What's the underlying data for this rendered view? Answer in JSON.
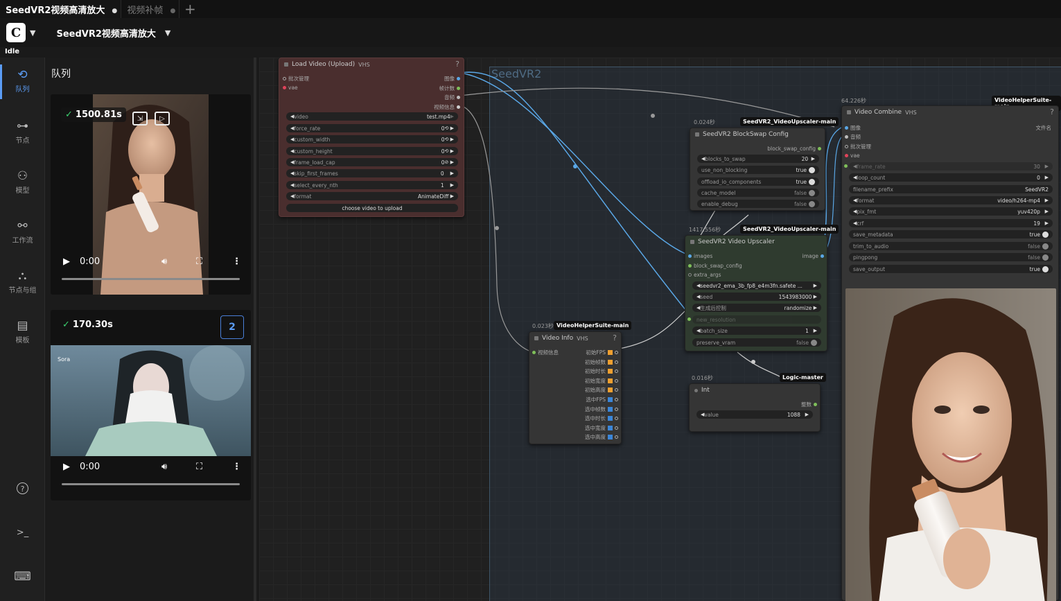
{
  "tabs": [
    {
      "label": "SeedVR2视频高清放大",
      "active": true
    },
    {
      "label": "视频补帧",
      "active": false
    }
  ],
  "workflow_name": "SeedVR2视频高清放大",
  "status": "Idle",
  "sidebar": [
    {
      "label": "队列",
      "icon": "history-icon",
      "glyph": "⟲",
      "active": true
    },
    {
      "label": "节点",
      "icon": "node-icon",
      "glyph": "⊶",
      "active": false
    },
    {
      "label": "模型",
      "icon": "model-library-icon",
      "glyph": "⚇",
      "active": false
    },
    {
      "label": "工作流",
      "icon": "workflow-icon",
      "glyph": "⚯",
      "active": false
    },
    {
      "label": "节点与组",
      "icon": "node-group-icon",
      "glyph": "⛬",
      "active": false
    },
    {
      "label": "模板",
      "icon": "template-icon",
      "glyph": "▤",
      "active": false
    }
  ],
  "sidebar_bottom": [
    {
      "icon": "help-icon",
      "glyph": "?"
    },
    {
      "icon": "terminal-icon",
      "glyph": ">_"
    },
    {
      "icon": "keyboard-icon",
      "glyph": "⌨"
    }
  ],
  "queue": {
    "title": "队列",
    "items": [
      {
        "time": "1500.81s",
        "check": "✓",
        "video_time": "0:00"
      },
      {
        "time": "170.30s",
        "check": "✓",
        "count": "2",
        "video_time": "0:00",
        "watermark": "Sora"
      }
    ]
  },
  "canvas": {
    "group_title": "SeedVR2",
    "load_video": {
      "title": "Load Video (Upload)",
      "badge": "VHS",
      "inputs": [
        "批次管理",
        "vae"
      ],
      "outputs": [
        "图像",
        "帧计数",
        "音频",
        "视频信息"
      ],
      "widgets": [
        {
          "label": "video",
          "value": "test.mp4"
        },
        {
          "label": "force_rate",
          "value": "0"
        },
        {
          "label": "custom_width",
          "value": "0"
        },
        {
          "label": "custom_height",
          "value": "0"
        },
        {
          "label": "frame_load_cap",
          "value": "0"
        },
        {
          "label": "skip_first_frames",
          "value": "0"
        },
        {
          "label": "select_every_nth",
          "value": "1"
        },
        {
          "label": "format",
          "value": "AnimateDiff"
        }
      ],
      "upload_label": "choose video to upload"
    },
    "blockswap": {
      "time": "0.024秒",
      "source": "SeedVR2_VideoUpscaler-main",
      "title": "SeedVR2 BlockSwap Config",
      "output": "block_swap_config",
      "widgets": [
        {
          "label": "blocks_to_swap",
          "value": "20"
        },
        {
          "label": "use_non_blocking",
          "value": "true"
        },
        {
          "label": "offload_io_components",
          "value": "true"
        },
        {
          "label": "cache_model",
          "value": "false"
        },
        {
          "label": "enable_debug",
          "value": "false"
        }
      ]
    },
    "upscaler": {
      "time": "1417.556秒",
      "source": "SeedVR2_VideoUpscaler-main",
      "title": "SeedVR2 Video Upscaler",
      "inputs": [
        "images",
        "block_swap_config",
        "extra_args"
      ],
      "output": "image",
      "widgets": [
        {
          "label": "seedvr2_ema_3b_fp8_e4m3fn.safete ...",
          "value": ""
        },
        {
          "label": "seed",
          "value": "1543983000"
        },
        {
          "label": "生成后控制",
          "value": "randomize"
        },
        {
          "label": "new_resolution",
          "value": ""
        },
        {
          "label": "batch_size",
          "value": "1"
        },
        {
          "label": "preserve_vram",
          "value": "false"
        }
      ]
    },
    "video_info": {
      "time": "0.023秒",
      "source": "VideoHelperSuite-main",
      "title": "Video Info",
      "badge": "VHS",
      "input": "视频信息",
      "outputs": [
        "初始FPS",
        "初始帧数",
        "初始时长",
        "初始宽度",
        "初始高度",
        "选中FPS",
        "选中帧数",
        "选中时长",
        "选中宽度",
        "选中高度"
      ]
    },
    "int_node": {
      "time": "0.016秒",
      "source": "Logic-master",
      "title": "Int",
      "output": "整数",
      "widget": {
        "label": "value",
        "value": "1088"
      }
    },
    "video_combine": {
      "time": "64.226秒",
      "source": "VideoHelperSuite-main",
      "title": "Video Combine",
      "badge": "VHS",
      "inputs": [
        "图像",
        "音频",
        "批次管理",
        "vae"
      ],
      "output": "文件名",
      "widgets": [
        {
          "label": "frame_rate",
          "value": "30"
        },
        {
          "label": "loop_count",
          "value": "0"
        },
        {
          "label": "filename_prefix",
          "value": "SeedVR2"
        },
        {
          "label": "format",
          "value": "video/h264-mp4"
        },
        {
          "label": "pix_fmt",
          "value": "yuv420p"
        },
        {
          "label": "crf",
          "value": "19"
        },
        {
          "label": "save_metadata",
          "value": "true"
        },
        {
          "label": "trim_to_audio",
          "value": "false"
        },
        {
          "label": "pingpong",
          "value": "false"
        },
        {
          "label": "save_output",
          "value": "true"
        }
      ]
    }
  }
}
